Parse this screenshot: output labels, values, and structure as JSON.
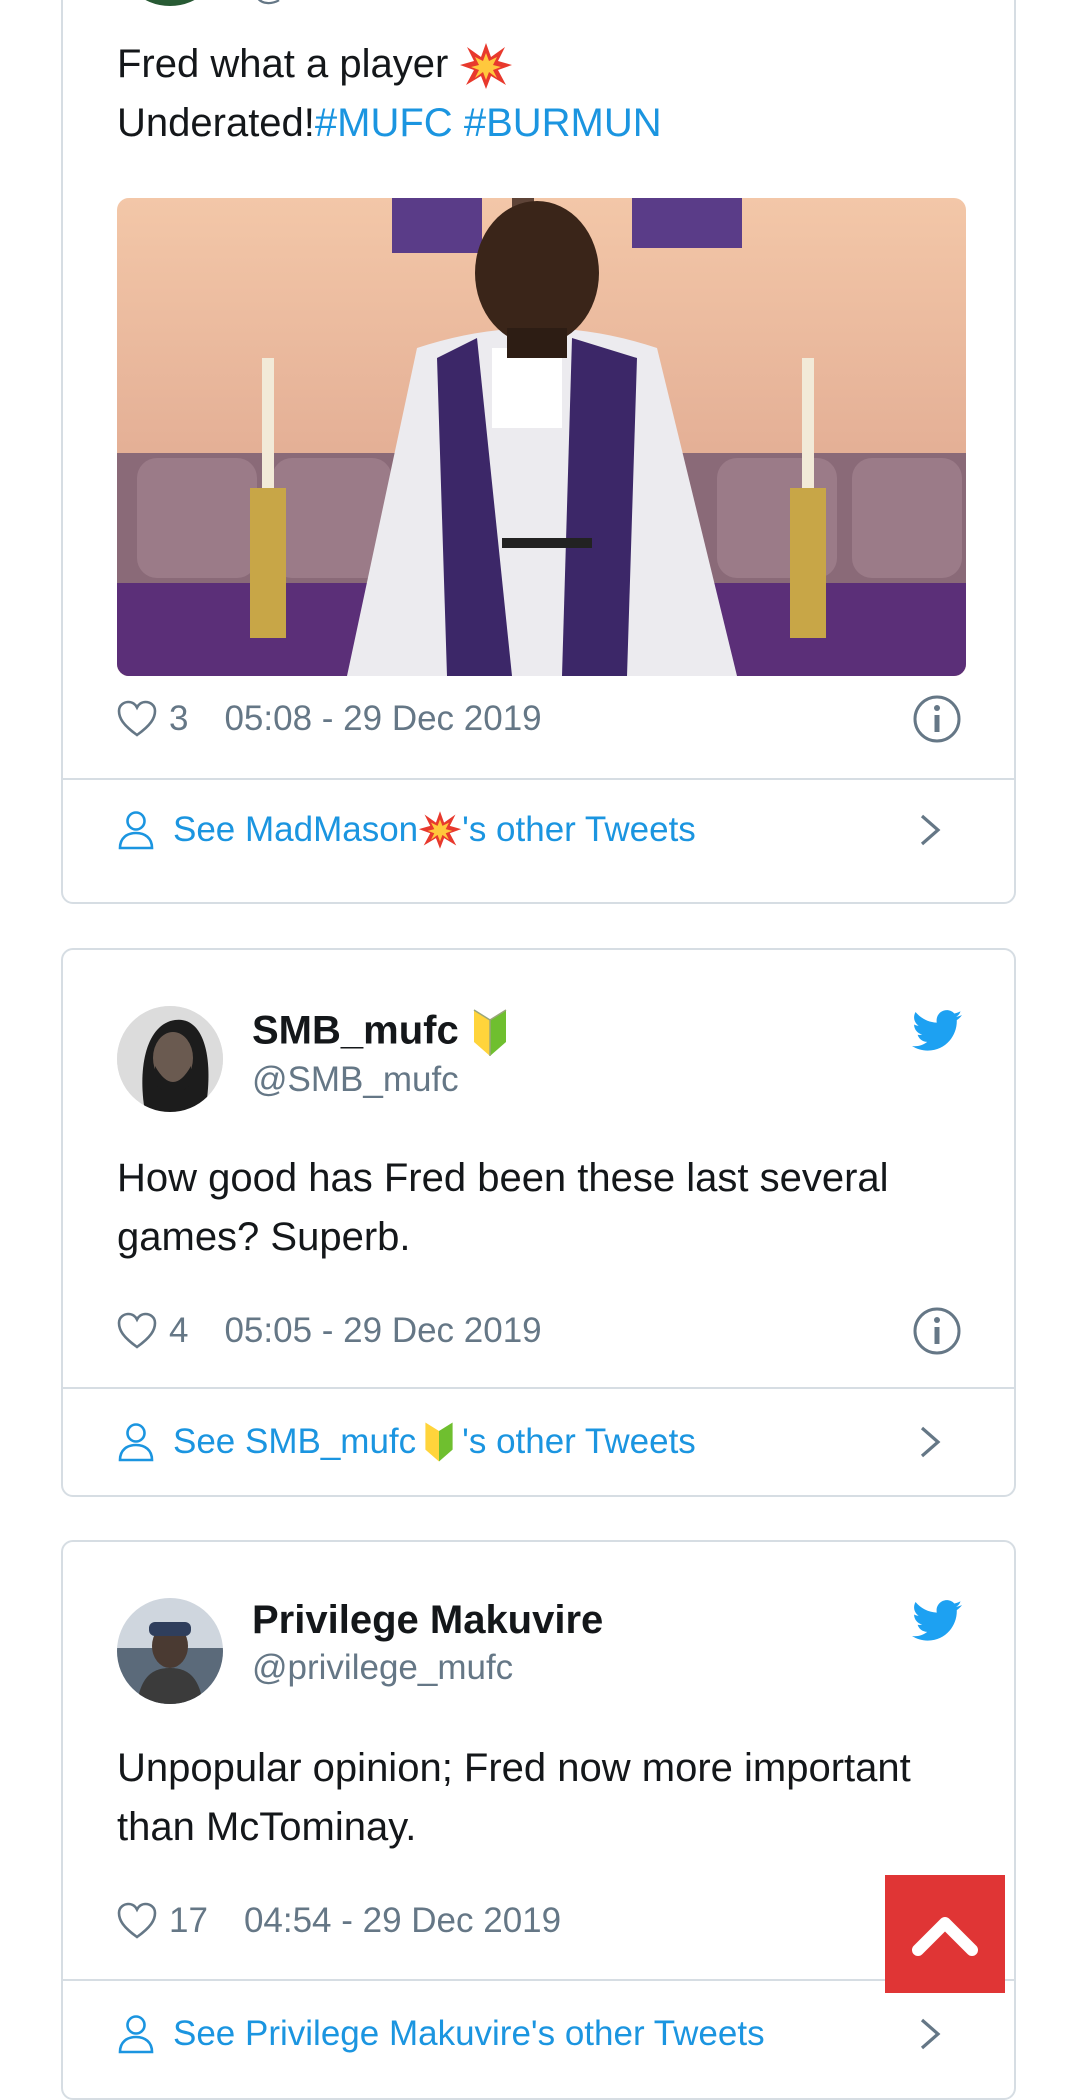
{
  "tweets": [
    {
      "name": "",
      "handle": "@",
      "text_line1": "Fred what a player",
      "text_line2_prefix": "Underated!",
      "hashtags": [
        "#MUFC",
        "#BURMUN"
      ],
      "likes": "3",
      "timestamp": "05:08 - 29 Dec 2019",
      "footer_prefix": "See MadMason",
      "footer_suffix": "'s other Tweets",
      "name_emoji": "collision"
    },
    {
      "name": "SMB_mufc",
      "handle": "@SMB_mufc",
      "text": "How good has Fred been these last several games? Superb.",
      "likes": "4",
      "timestamp": "05:05 - 29 Dec 2019",
      "footer_prefix": "See SMB_mufc",
      "footer_suffix": "'s other Tweets",
      "name_emoji": "beginner-badge"
    },
    {
      "name": "Privilege Makuvire",
      "handle": "@privilege_mufc",
      "text": "Unpopular opinion; Fred now more important than McTominay.",
      "likes": "17",
      "timestamp": "04:54 - 29 Dec 2019",
      "footer": "See Privilege Makuvire's other Tweets"
    }
  ],
  "colors": {
    "link": "#1b95e0",
    "meta": "#657786",
    "border": "#d6dde3",
    "scroll_top_bg": "#e03535"
  },
  "icons": [
    "heart-icon",
    "info-icon",
    "person-icon",
    "chevron-right-icon",
    "twitter-bird-icon",
    "chevron-up-icon",
    "collision-emoji",
    "beginner-badge-emoji"
  ]
}
